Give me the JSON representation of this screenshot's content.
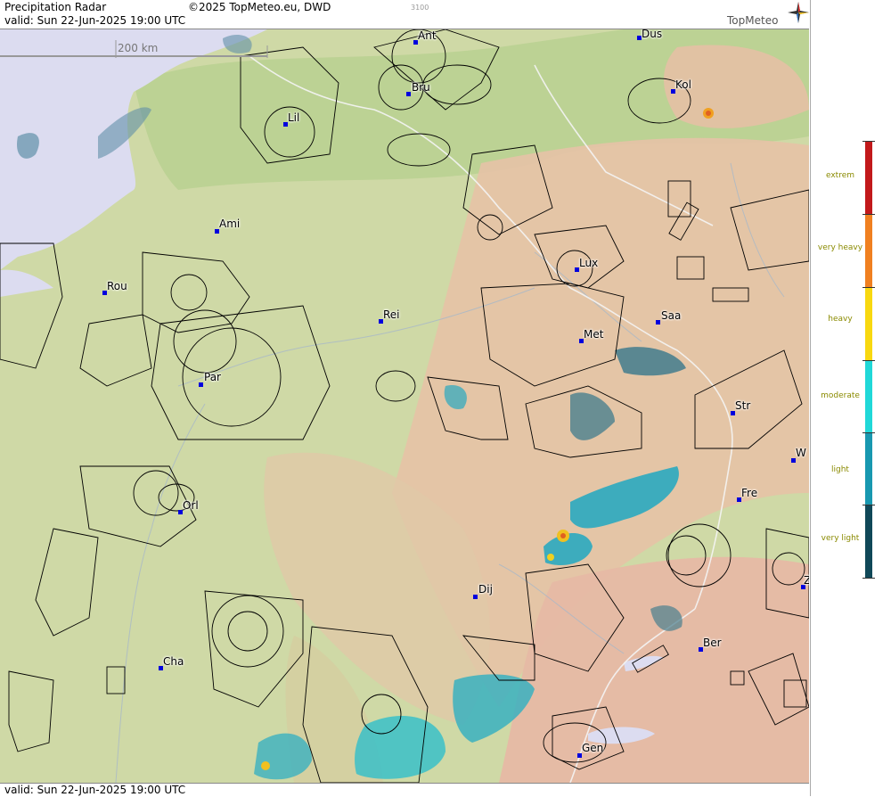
{
  "header": {
    "title": "Precipitation Radar",
    "copyright": "©2025 TopMeteo.eu, DWD",
    "valid": "valid:  Sun  22-Jun-2025 19:00 UTC",
    "code": "3100",
    "logo": "TopMeteo"
  },
  "footer": {
    "valid": "valid:  Sun  22-Jun-2025 19:00 UTC"
  },
  "scale": {
    "label": "200 km"
  },
  "legend": {
    "labels": [
      "extrem",
      "very heavy",
      "heavy",
      "moderate",
      "light",
      "very light"
    ],
    "colors": [
      "#c2191b",
      "#f08020",
      "#f8d810",
      "#20d8d8",
      "#1898b0",
      "#104858"
    ]
  },
  "cities": [
    "Ant",
    "Dus",
    "Bru",
    "Kol",
    "Lil",
    "Ami",
    "Lux",
    "Rou",
    "Rei",
    "Saa",
    "Met",
    "Par",
    "Str",
    "W",
    "Fre",
    "Orl",
    "Dij",
    "Ber",
    "Cha",
    "Gen",
    "Z"
  ],
  "colors": {
    "land": "#c9d7a0",
    "sea": "#dcdcf0",
    "mountain": "#e4b8a4",
    "radar_light": "#2aa8c0",
    "radar_very_light": "#4a7f8f"
  }
}
